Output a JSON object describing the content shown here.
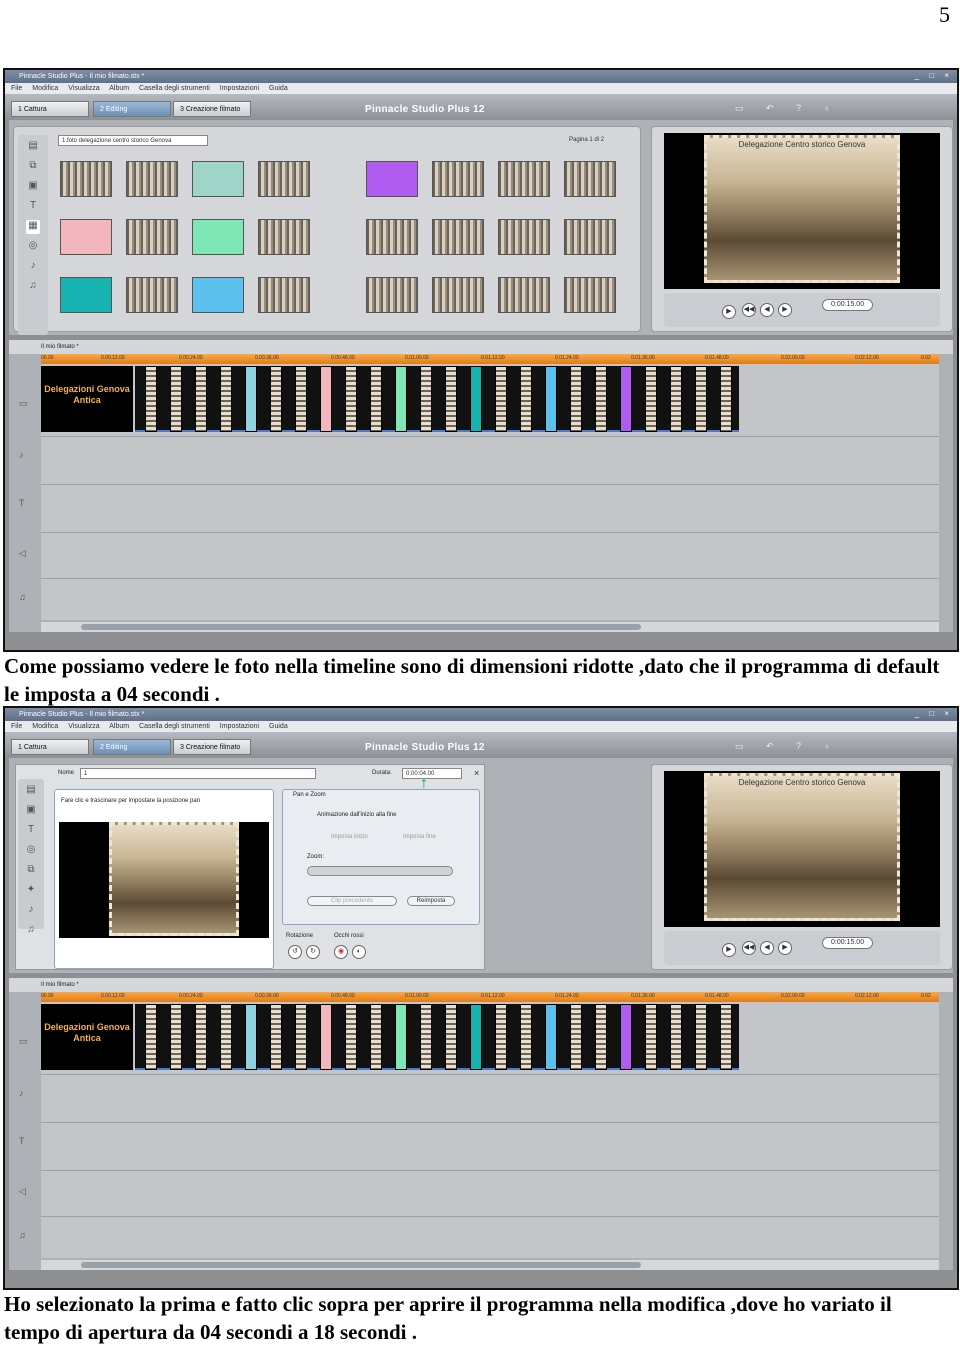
{
  "page_number": "5",
  "caption_1": "Come possiamo vedere le foto nella timeline sono di dimensioni ridotte ,dato che il programma di default le imposta a 04 secondi .",
  "caption_2": "Ho selezionato la prima e fatto clic sopra per aprire il programma nella modifica ,dove ho variato il tempo di apertura da 04 secondi a 18 secondi .",
  "app": {
    "window_title": "Pinnacle Studio Plus - Il mio filmato.stx *",
    "menu": [
      "File",
      "Modifica",
      "Visualizza",
      "Album",
      "Casella degli strumenti",
      "Impostazioni",
      "Guida"
    ],
    "tabs": [
      "1 Cattura",
      "2 Editing",
      "3 Creazione filmato"
    ],
    "active_tab": 1,
    "brand": "Pinnacle Studio Plus 12",
    "album_folder": "1.foto delegazione centro storico Genova",
    "pager": "Pagina 1 di 2",
    "preview_caption": "Delegazione Centro storico Genova",
    "timecode": "0:00:15.00",
    "timeline_name": "Il mio filmato *",
    "title_clip": "Delegazioni Genova Antica",
    "ruler": [
      "00.00",
      "0.00.12.00",
      "0.00.24.00",
      "0.00.36.00",
      "0.00.48.00",
      "0.01.00.00",
      "0.01.12.00",
      "0.01.24.00",
      "0.01.36.00",
      "0.01.48.00",
      "0.02.00.00",
      "0.02.12.00",
      "0.02"
    ]
  },
  "editor": {
    "name_label": "Nome",
    "name_value": "1",
    "duration_label": "Durata:",
    "duration_value": "0:00:04.00",
    "instruction": "Fare clic e trascinare per impostare la posizione pan",
    "pan_zoom": "Pan e Zoom",
    "animate": "Animazione dall'inizio alla fine",
    "set_start": "Imposta inizio",
    "set_end": "Imposta fine",
    "zoom": "Zoom:",
    "prev_clip": "Clip precedente",
    "reset": "Reimposta",
    "rotation": "Rotazione",
    "red_eye": "Occhi rossi"
  }
}
